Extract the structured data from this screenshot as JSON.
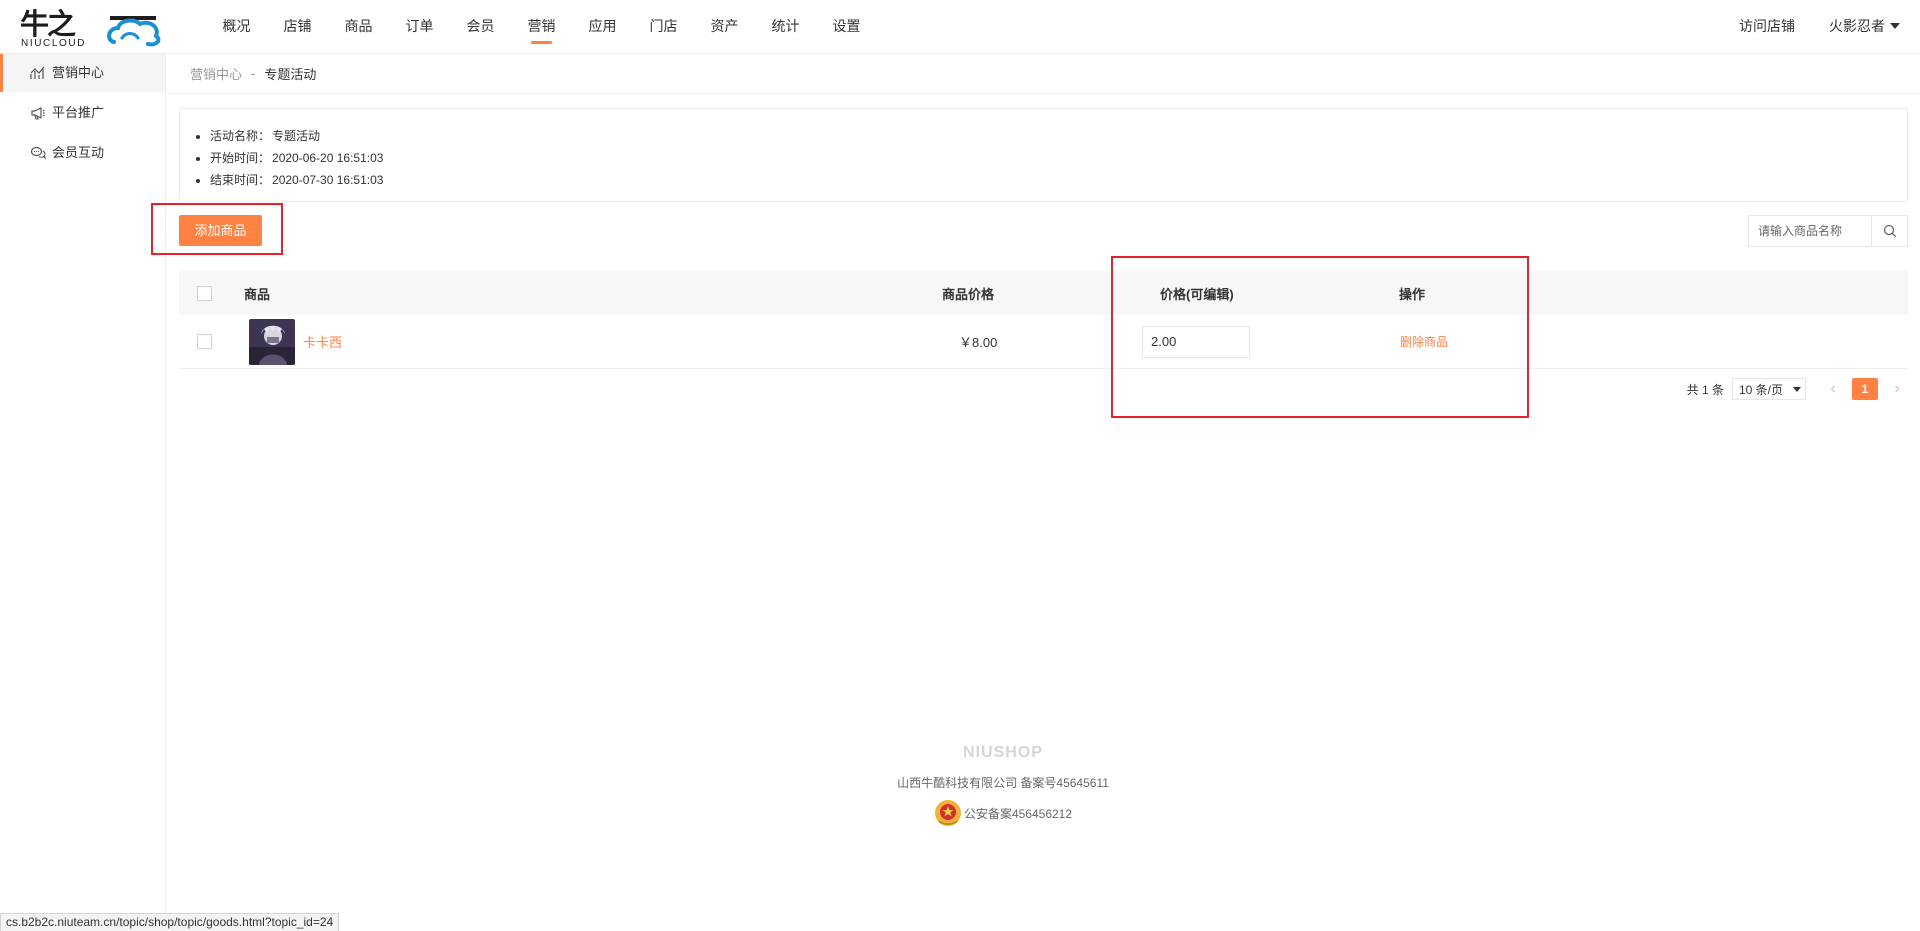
{
  "logo": {
    "cn": "牛之",
    "en": "NIUCLOUD"
  },
  "topnav": {
    "items": [
      "概况",
      "店铺",
      "商品",
      "订单",
      "会员",
      "营销",
      "应用",
      "门店",
      "资产",
      "统计",
      "设置"
    ],
    "active": "营销"
  },
  "top_right": {
    "visit_store": "访问店铺",
    "username": "火影忍者"
  },
  "sidebar": {
    "items": [
      {
        "label": "营销中心",
        "icon": "chart-icon",
        "active": true
      },
      {
        "label": "平台推广",
        "icon": "megaphone-icon",
        "active": false
      },
      {
        "label": "会员互动",
        "icon": "chat-icon",
        "active": false
      }
    ]
  },
  "breadcrumb": {
    "parent": "营销中心",
    "separator": "-",
    "current": "专题活动"
  },
  "activity": {
    "name_label": "活动名称：",
    "name": "专题活动",
    "start_label": "开始时间：",
    "start": "2020-06-20 16:51:03",
    "end_label": "结束时间：",
    "end": "2020-07-30 16:51:03"
  },
  "toolbar": {
    "add_label": "添加商品",
    "search_placeholder": "请输入商品名称"
  },
  "table": {
    "headers": {
      "goods": "商品",
      "price": "商品价格",
      "edit_price": "价格(可编辑)",
      "action": "操作"
    },
    "rows": [
      {
        "name": "卡卡西",
        "price": "￥8.00",
        "edit_price": "2.00",
        "action": "删除商品"
      }
    ]
  },
  "pagination": {
    "total": "共 1 条",
    "page_size": "10 条/页",
    "current_page": "1"
  },
  "footer": {
    "brand": "NIUSHOP",
    "company": "山西牛酷科技有限公司  备案号45645611",
    "police": "公安备案456456212"
  },
  "statusbar": {
    "url": "cs.b2b2c.niuteam.cn/topic/shop/topic/goods.html?topic_id=24"
  },
  "colors": {
    "accent": "#ff8143",
    "highlight_box": "#e8222a",
    "logo_blue": "#1a8fd6"
  }
}
